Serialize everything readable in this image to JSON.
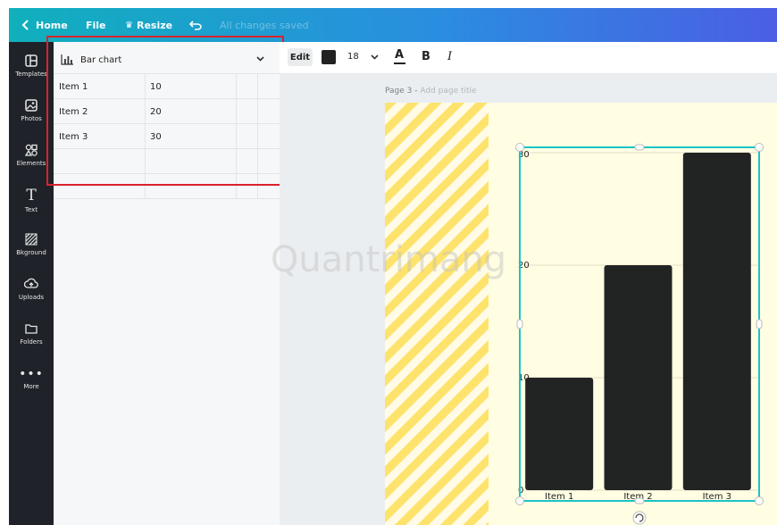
{
  "topbar": {
    "home_label": "Home",
    "file_label": "File",
    "resize_label": "Resize",
    "status": "All changes saved"
  },
  "sidebar": {
    "items": [
      {
        "label": "Templates",
        "icon": "templates-icon"
      },
      {
        "label": "Photos",
        "icon": "photos-icon"
      },
      {
        "label": "Elements",
        "icon": "elements-icon"
      },
      {
        "label": "Text",
        "icon": "text-icon"
      },
      {
        "label": "Bkground",
        "icon": "background-icon"
      },
      {
        "label": "Uploads",
        "icon": "uploads-icon"
      },
      {
        "label": "Folders",
        "icon": "folders-icon"
      },
      {
        "label": "More",
        "icon": "more-icon"
      }
    ]
  },
  "panel": {
    "chart_type": "Bar chart",
    "rows": [
      {
        "label": "Item 1",
        "value": "10"
      },
      {
        "label": "Item 2",
        "value": "20"
      },
      {
        "label": "Item 3",
        "value": "30"
      }
    ]
  },
  "toolbar": {
    "edit_label": "Edit",
    "font_size": "18",
    "color_swatch": "#222222"
  },
  "page": {
    "label": "Page 3 - ",
    "title_placeholder": "Add page title"
  },
  "watermark": "Quantrimang",
  "chart_data": {
    "type": "bar",
    "categories": [
      "Item 1",
      "Item 2",
      "Item 3"
    ],
    "values": [
      10,
      20,
      30
    ],
    "yticks": [
      0,
      10,
      20,
      30
    ],
    "ylim": [
      0,
      30
    ],
    "bar_color": "#222424",
    "grid": true
  }
}
